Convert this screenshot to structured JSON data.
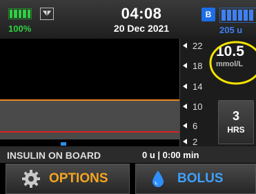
{
  "status": {
    "battery_percent": "100%",
    "battery_level": 1.0,
    "time": "04:08",
    "date": "20 Dec 2021",
    "bluetooth_badge": "B",
    "cartridge_units": "205 u",
    "cartridge_level": 1.0
  },
  "graph": {
    "y_ticks": [
      "22",
      "18",
      "14",
      "10",
      "6",
      "2"
    ],
    "target_high_color": "#f08a1c",
    "target_low_color": "#e02020",
    "band_color": "#4a4a4a"
  },
  "glucose": {
    "value": "10.5",
    "unit": "mmol/L"
  },
  "hours_button": {
    "value": "3",
    "unit": "HRS"
  },
  "insulin_on_board": {
    "label": "INSULIN ON BOARD",
    "value": "0 u | 0:00 min"
  },
  "buttons": {
    "options": "OPTIONS",
    "bolus": "BOLUS"
  },
  "colors": {
    "options_accent": "#f6a51e",
    "bolus_accent": "#3fa1ff",
    "battery_green": "#2fd03f",
    "highlight_ring": "#f2e400"
  },
  "icons": {
    "options": "gear-icon",
    "bolus": "drop-icon",
    "status": [
      "battery-icon",
      "wifi-icon",
      "bluetooth-icon",
      "cartridge-icon"
    ]
  }
}
